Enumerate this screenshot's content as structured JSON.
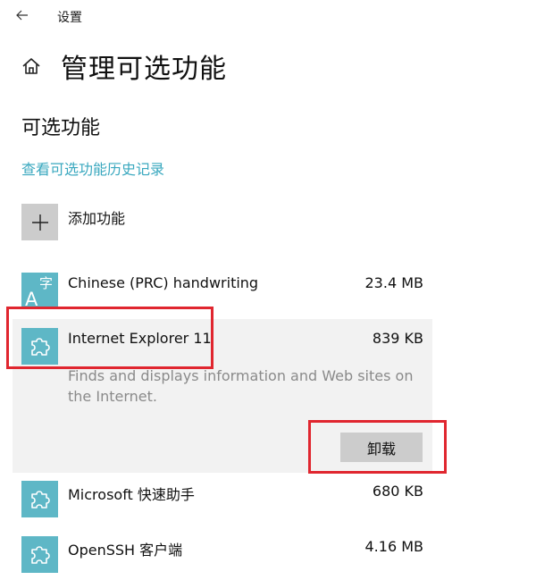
{
  "app": {
    "title": "设置"
  },
  "page": {
    "title": "管理可选功能"
  },
  "section": {
    "title": "可选功能",
    "history_link": "查看可选功能历史记录",
    "add_label": "添加功能"
  },
  "features": [
    {
      "name": "Chinese (PRC) handwriting",
      "size": "23.4 MB",
      "icon": "language-icon"
    },
    {
      "name": "Internet Explorer 11",
      "size": "839 KB",
      "icon": "puzzle-icon",
      "description": "Finds and displays information and Web sites on the Internet.",
      "action_label": "卸载",
      "selected": true
    },
    {
      "name": "Microsoft 快速助手",
      "size": "680 KB",
      "icon": "puzzle-icon"
    },
    {
      "name": "OpenSSH 客户端",
      "size": "4.16 MB",
      "icon": "puzzle-icon"
    }
  ],
  "colors": {
    "accent": "#3aa8bf",
    "icon_bg": "#5eb7c6",
    "selected_bg": "#f2f2f2",
    "highlight": "#e0262f"
  },
  "language_icon_glyphs": {
    "latin": "A",
    "cjk": "字"
  }
}
